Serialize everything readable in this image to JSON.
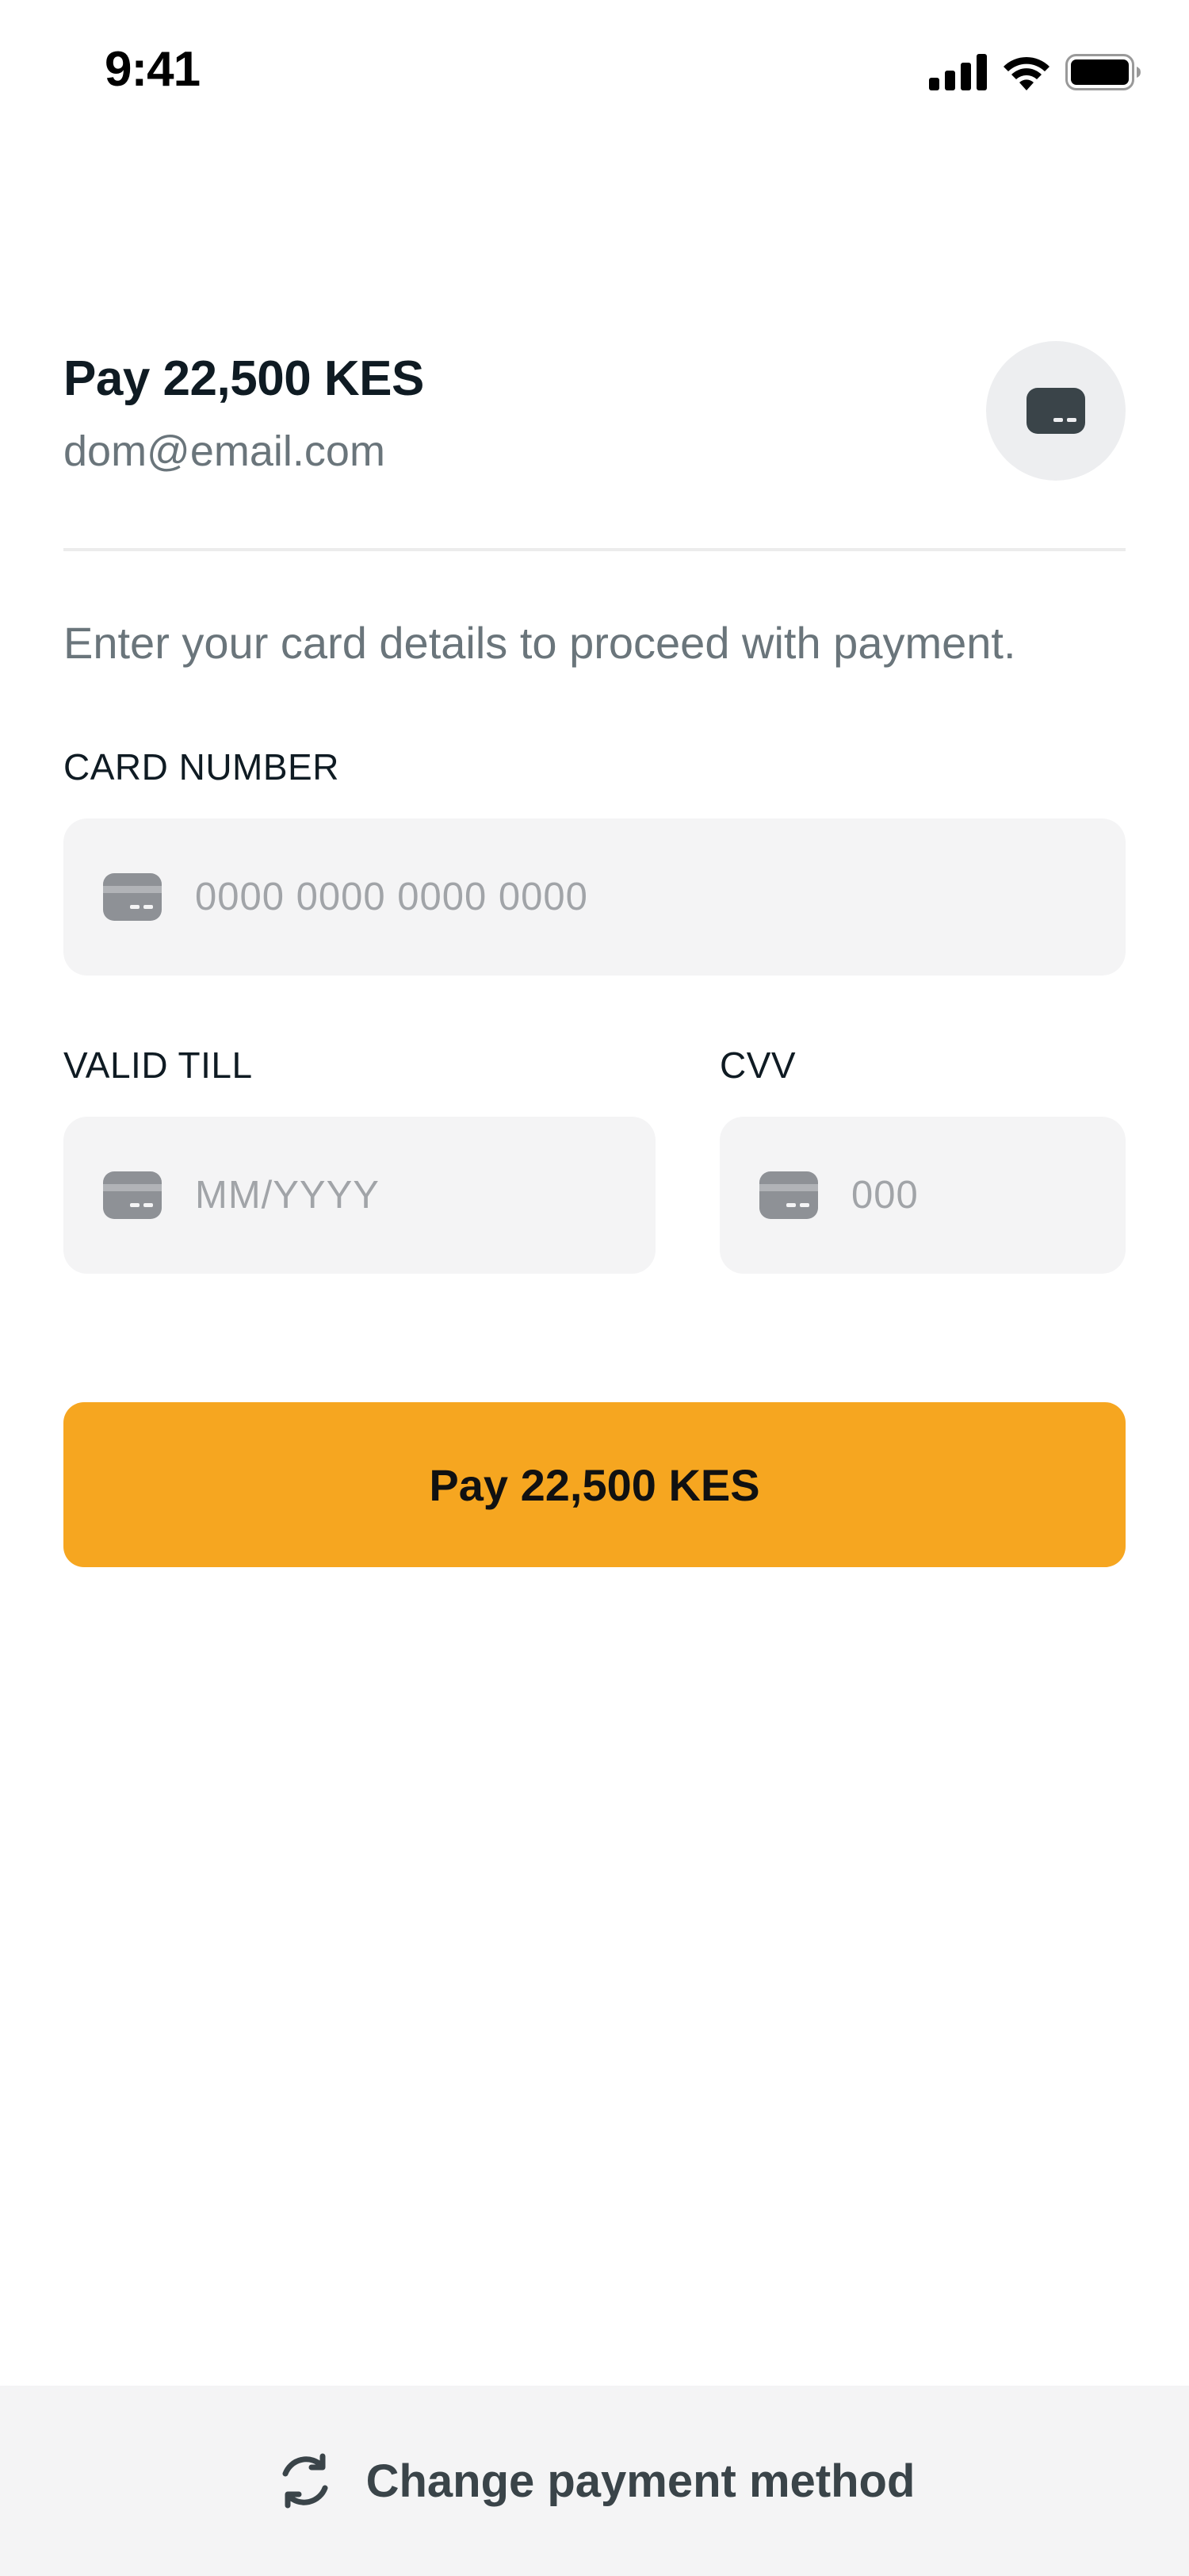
{
  "status_bar": {
    "time": "9:41"
  },
  "header": {
    "title": "Pay 22,500 KES",
    "email": "dom@email.com",
    "badge_icon": "credit-card-icon"
  },
  "intro": "Enter your card details to proceed with payment.",
  "card_number": {
    "label": "CARD NUMBER",
    "placeholder": "0000 0000 0000 0000"
  },
  "valid_till": {
    "label": "VALID TILL",
    "placeholder": "MM/YYYY"
  },
  "cvv": {
    "label": "CVV",
    "placeholder": "000"
  },
  "pay_button": {
    "label": "Pay 22,500 KES",
    "color": "#f6a620"
  },
  "footer": {
    "label": "Change payment method",
    "icon": "refresh-icon"
  }
}
